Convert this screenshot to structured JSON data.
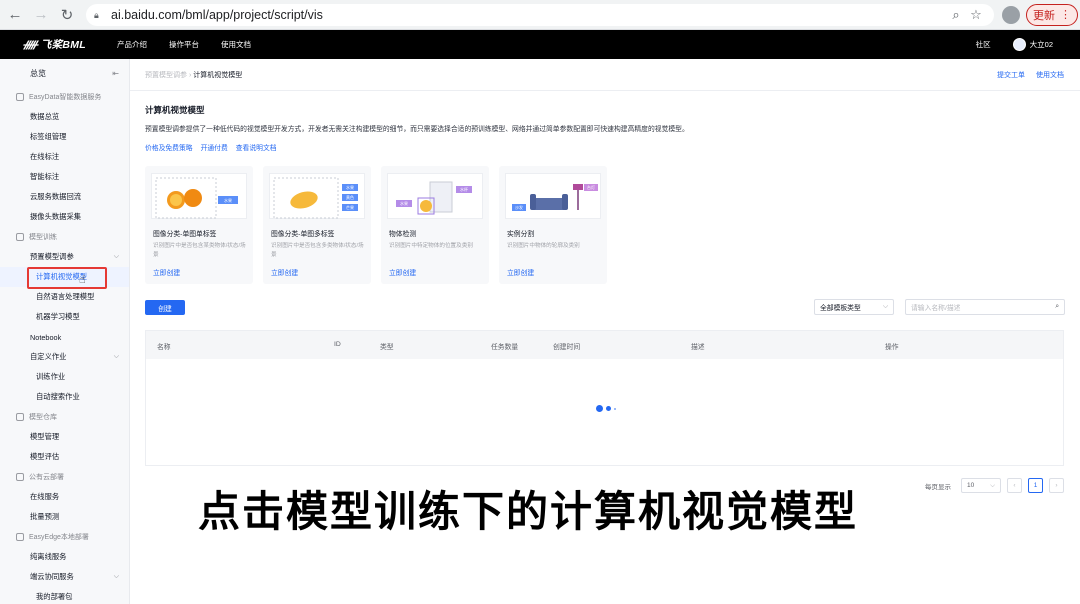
{
  "browser": {
    "url": "ai.baidu.com/bml/app/project/script/vis",
    "update_label": "更新"
  },
  "topnav": {
    "brand": "飞桨BML",
    "menu": [
      "产品介绍",
      "操作平台",
      "使用文档"
    ],
    "community": "社区",
    "user": "大立02"
  },
  "sidebar": {
    "overview": "总览",
    "groups": [
      {
        "title": "EasyData智能数据服务",
        "items": [
          "数据总览",
          "标签组管理",
          "在线标注",
          "智能标注",
          "云服务数据回流",
          "摄像头数据采集"
        ]
      },
      {
        "title": "模型训练",
        "items": [
          "预置模型调参",
          "计算机视觉模型",
          "自然语言处理模型",
          "机器学习模型",
          "Notebook",
          "自定义作业",
          "训练作业",
          "自动搜索作业"
        ]
      },
      {
        "title": "模型仓库",
        "items": [
          "模型管理",
          "模型评估"
        ]
      },
      {
        "title": "公有云部署",
        "items": [
          "在线服务",
          "批量预测"
        ]
      },
      {
        "title": "EasyEdge本地部署",
        "items": [
          "纯离线服务",
          "端云协同服务",
          "我的部署包"
        ]
      }
    ]
  },
  "main": {
    "breadcrumb_parent": "预置模型调参",
    "breadcrumb_current": "计算机视觉模型",
    "top_links": [
      "提交工单",
      "使用文档"
    ],
    "title": "计算机视觉模型",
    "description": "预置模型调参提供了一种低代码的视觉模型开发方式，开发者无需关注构建模型的细节，而只需要选择合适的预训练模型、网络并通过简单参数配置即可快速构建高精度的视觉模型。",
    "desc_links": [
      "价格及免费策略",
      "开通付费",
      "查看说明文档"
    ],
    "cards": [
      {
        "name": "图像分类-单图单标签",
        "desc": "识别图片中是否包含某类物体/状态/场景",
        "link": "立即创建",
        "tags": [
          "水果"
        ]
      },
      {
        "name": "图像分类-单图多标签",
        "desc": "识别图片中是否包含多类物体/状态/场景",
        "link": "立即创建",
        "tags": [
          "水果",
          "黄色",
          "芒果"
        ]
      },
      {
        "name": "物体检测",
        "desc": "识别图片中特定物体的位置及类别",
        "link": "立即创建",
        "tags": [
          "水杯",
          "水果"
        ]
      },
      {
        "name": "实例分割",
        "desc": "识别图片中物体的轮廓及类别",
        "link": "立即创建",
        "tags": [
          "台灯",
          "沙发"
        ]
      }
    ],
    "create_label": "创建",
    "filter_select": "全部模板类型",
    "search_placeholder": "请输入名称/描述",
    "table_headers": [
      "名称",
      "ID",
      "类型",
      "任务数量",
      "创建时间",
      "描述",
      "操作"
    ],
    "pager": {
      "label": "每页显示",
      "size": "10",
      "current_page": "1"
    }
  },
  "overlay_caption": "点击模型训练下的计算机视觉模型",
  "colors": {
    "accent": "#2468f2",
    "highlight": "#e53935"
  }
}
